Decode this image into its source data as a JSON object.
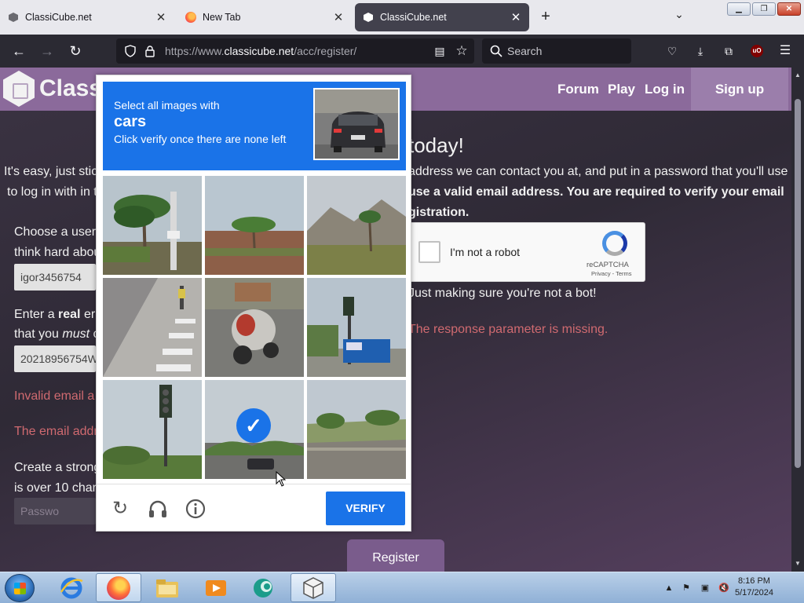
{
  "browser": {
    "tabs": [
      {
        "title": "ClassiCube.net",
        "active": false,
        "favicon": "classicube-icon"
      },
      {
        "title": "New Tab",
        "active": false,
        "favicon": "firefox-icon"
      },
      {
        "title": "ClassiCube.net",
        "active": true,
        "favicon": "classicube-icon"
      }
    ],
    "url_prefix": "https://www.",
    "url_domain": "classicube.net",
    "url_path": "/acc/register/",
    "search_placeholder": "Search",
    "ublock_label": "uO"
  },
  "site": {
    "logo_text": "Classi",
    "nav": {
      "forum": "Forum",
      "play": "Play",
      "login": "Log in",
      "signup": "Sign up"
    },
    "heading_fragment": "today!",
    "intro_left_1": "It's easy, just stic",
    "intro_right_1": "address we can contact you at, and put in a password that you'll use",
    "intro_left_2": "to log in with in t",
    "intro_right_2": "use a valid email address. You are required to verify your email",
    "intro_right_3": "gistration.",
    "username_prompt_1": "Choose a user",
    "username_prompt_2": "think hard abou",
    "username_value": "igor3456754",
    "email_prompt_1_a": "Enter a ",
    "email_prompt_1_b": "real",
    "email_prompt_1_c": " er",
    "email_prompt_2_a": "that you ",
    "email_prompt_2_b": "must",
    "email_prompt_2_c": " c",
    "email_value": "20218956754W",
    "email_error_1": "Invalid email a",
    "email_error_2": "The email addr",
    "password_prompt_1": "Create a strong",
    "password_prompt_2": "is over 10 char",
    "password_placeholder": "Passwo",
    "captcha_note": "Just making sure you're not a bot!",
    "captcha_error": "The response parameter is missing.",
    "register_label": "Register"
  },
  "recaptcha": {
    "checkbox_label": "I'm not a robot",
    "brand": "reCAPTCHA",
    "links": "Privacy - Terms",
    "challenge": {
      "line1": "Select all images with",
      "target": "cars",
      "line3": "Click verify once there are none left",
      "verify_label": "VERIFY",
      "tiles": [
        {
          "name": "palm-trees-pole",
          "selected": false
        },
        {
          "name": "palm-field",
          "selected": false
        },
        {
          "name": "hills-palm",
          "selected": false
        },
        {
          "name": "crosswalk-road",
          "selected": false
        },
        {
          "name": "motorcycle",
          "selected": false
        },
        {
          "name": "traffic-light-blue-booth",
          "selected": false
        },
        {
          "name": "traffic-light-trees",
          "selected": false
        },
        {
          "name": "road-car",
          "selected": true
        },
        {
          "name": "road-verge",
          "selected": false
        }
      ],
      "footer_icons": [
        "reload-icon",
        "audio-icon",
        "info-icon"
      ]
    }
  },
  "taskbar": {
    "time": "8:16 PM",
    "date": "5/17/2024",
    "apps": [
      "ie-icon",
      "firefox-icon",
      "explorer-icon",
      "media-player-icon",
      "app-icon",
      "classicube-icon"
    ]
  }
}
